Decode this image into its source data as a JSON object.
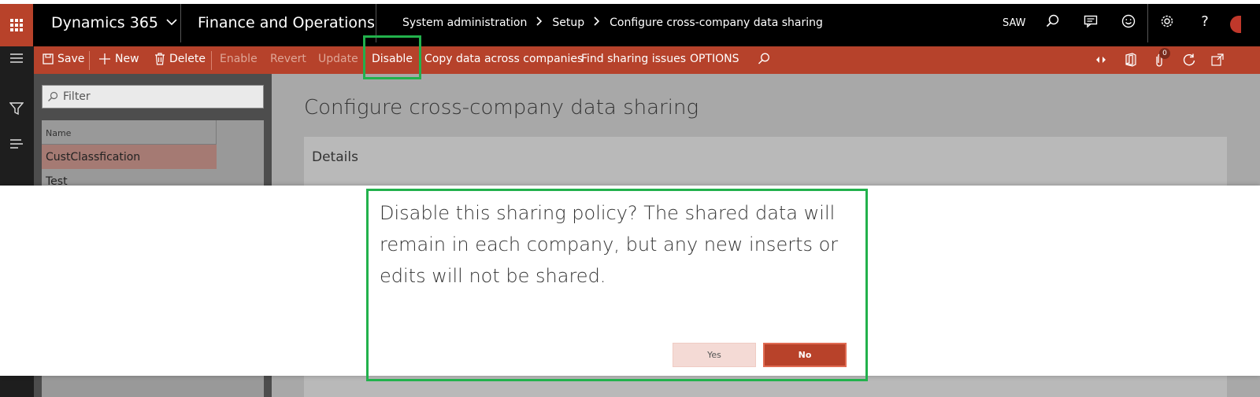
{
  "topbar": {
    "brand": "Dynamics 365",
    "app_name": "Finance and Operations",
    "breadcrumb": [
      "System administration",
      "Setup",
      "Configure cross-company data sharing"
    ],
    "company": "SAW",
    "icons": [
      "waffle-icon",
      "search-icon",
      "message-icon",
      "smiley-icon",
      "gear-icon",
      "help-icon"
    ]
  },
  "actions": {
    "save": "Save",
    "new": "New",
    "delete": "Delete",
    "enable": "Enable",
    "revert": "Revert",
    "update": "Update",
    "disable": "Disable",
    "copy": "Copy data across companies",
    "find": "Find sharing issues",
    "options": "OPTIONS",
    "notification_count": "0"
  },
  "list": {
    "filter_placeholder": "Filter",
    "column_header": "Name",
    "rows": [
      "CustClassfication",
      "Test"
    ]
  },
  "main": {
    "title": "Configure cross-company data sharing",
    "details_label": "Details"
  },
  "dialog": {
    "message": "Disable this sharing policy? The shared data will remain in each company, but any new inserts or edits will not be shared.",
    "yes_label": "Yes",
    "no_label": "No"
  },
  "colors": {
    "accent": "#b8422a",
    "highlight": "#22b14c"
  }
}
